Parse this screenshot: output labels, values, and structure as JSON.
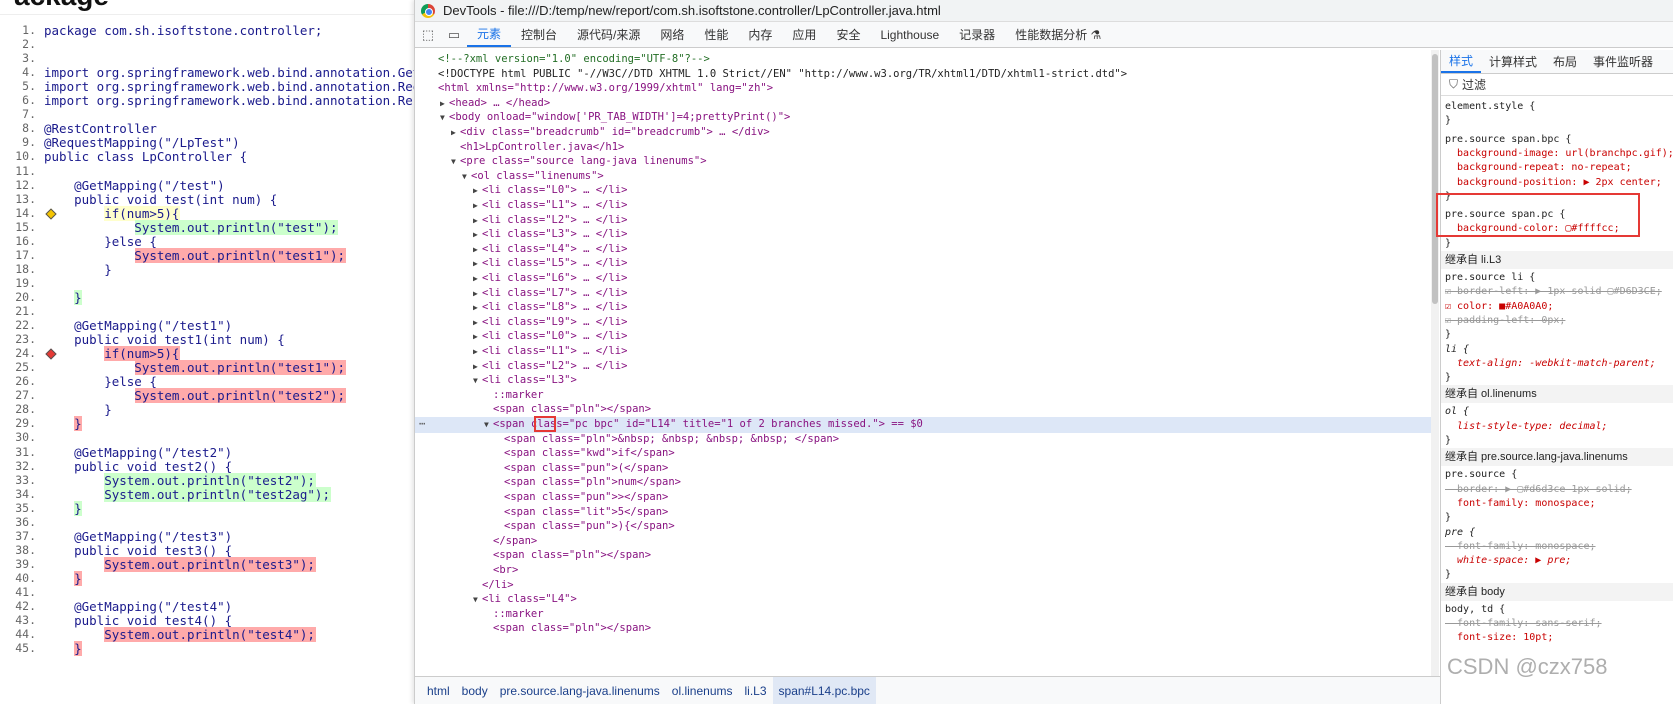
{
  "page_title_fragment": "ackage",
  "code_lines": [
    {
      "n": "1.",
      "t": "package com.sh.isoftstone.controller;"
    },
    {
      "n": "2.",
      "t": ""
    },
    {
      "n": "3.",
      "t": ""
    },
    {
      "n": "4.",
      "t": "import org.springframework.web.bind.annotation.GetMa"
    },
    {
      "n": "5.",
      "t": "import org.springframework.web.bind.annotation.Reque"
    },
    {
      "n": "6.",
      "t": "import org.springframework.web.bind.annotation.RestC"
    },
    {
      "n": "7.",
      "t": ""
    },
    {
      "n": "8.",
      "t": "@RestController"
    },
    {
      "n": "9.",
      "t": "@RequestMapping(\"/LpTest\")"
    },
    {
      "n": "10.",
      "t": "public class LpController {"
    },
    {
      "n": "11.",
      "t": ""
    },
    {
      "n": "12.",
      "t": "    @GetMapping(\"/test\")"
    },
    {
      "n": "13.",
      "t": "    public void test(int num) {"
    },
    {
      "n": "14.",
      "t": "        if(num>5){",
      "h": "y",
      "m": "y"
    },
    {
      "n": "15.",
      "t": "            System.out.println(\"test\");",
      "h": "g"
    },
    {
      "n": "16.",
      "t": "        }else {"
    },
    {
      "n": "17.",
      "t": "            System.out.println(\"test1\");",
      "h": "r"
    },
    {
      "n": "18.",
      "t": "        }"
    },
    {
      "n": "19.",
      "t": ""
    },
    {
      "n": "20.",
      "t": "    }",
      "h": "g"
    },
    {
      "n": "21.",
      "t": ""
    },
    {
      "n": "22.",
      "t": "    @GetMapping(\"/test1\")"
    },
    {
      "n": "23.",
      "t": "    public void test1(int num) {"
    },
    {
      "n": "24.",
      "t": "        if(num>5){",
      "h": "r",
      "m": "r"
    },
    {
      "n": "25.",
      "t": "            System.out.println(\"test1\");",
      "h": "r"
    },
    {
      "n": "26.",
      "t": "        }else {"
    },
    {
      "n": "27.",
      "t": "            System.out.println(\"test2\");",
      "h": "r"
    },
    {
      "n": "28.",
      "t": "        }"
    },
    {
      "n": "29.",
      "t": "    }",
      "h": "r"
    },
    {
      "n": "30.",
      "t": ""
    },
    {
      "n": "31.",
      "t": "    @GetMapping(\"/test2\")"
    },
    {
      "n": "32.",
      "t": "    public void test2() {"
    },
    {
      "n": "33.",
      "t": "        System.out.println(\"test2\");",
      "h": "g"
    },
    {
      "n": "34.",
      "t": "        System.out.println(\"test2ag\");",
      "h": "g"
    },
    {
      "n": "35.",
      "t": "    }",
      "h": "g"
    },
    {
      "n": "36.",
      "t": ""
    },
    {
      "n": "37.",
      "t": "    @GetMapping(\"/test3\")"
    },
    {
      "n": "38.",
      "t": "    public void test3() {"
    },
    {
      "n": "39.",
      "t": "        System.out.println(\"test3\");",
      "h": "r"
    },
    {
      "n": "40.",
      "t": "    }",
      "h": "r"
    },
    {
      "n": "41.",
      "t": ""
    },
    {
      "n": "42.",
      "t": "    @GetMapping(\"/test4\")"
    },
    {
      "n": "43.",
      "t": "    public void test4() {"
    },
    {
      "n": "44.",
      "t": "        System.out.println(\"test4\");",
      "h": "r"
    },
    {
      "n": "45.",
      "t": "    }",
      "h": "r"
    }
  ],
  "devtools": {
    "title": "DevTools - file:///D:/temp/new/report/com.sh.isoftstone.controller/LpController.java.html",
    "tabs": [
      "元素",
      "控制台",
      "源代码/来源",
      "网络",
      "性能",
      "内存",
      "应用",
      "安全",
      "Lighthouse",
      "记录器",
      "性能数据分析 ⚗"
    ],
    "dom_lines": [
      {
        "i": 0,
        "x": "",
        "h": "<!--?xml version=\"1.0\" encoding=\"UTF-8\"?-->",
        "c": "cm"
      },
      {
        "i": 0,
        "x": "",
        "h": "<!DOCTYPE html PUBLIC \"-//W3C//DTD XHTML 1.0 Strict//EN\" \"http://www.w3.org/TR/xhtml1/DTD/xhtml1-strict.dtd\">",
        "c": "tx"
      },
      {
        "i": 0,
        "x": "",
        "h": "<html xmlns=\"http://www.w3.org/1999/xhtml\" lang=\"zh\">",
        "c": "tg"
      },
      {
        "i": 1,
        "x": "▶",
        "h": "<head> … </head>",
        "c": "tg"
      },
      {
        "i": 1,
        "x": "▼",
        "h": "<body onload=\"window['PR_TAB_WIDTH']=4;prettyPrint()\">",
        "c": "tg"
      },
      {
        "i": 2,
        "x": "▶",
        "h": "<div class=\"breadcrumb\" id=\"breadcrumb\"> … </div>",
        "c": "tg"
      },
      {
        "i": 2,
        "x": "",
        "h": "<h1>LpController.java</h1>",
        "c": "tg"
      },
      {
        "i": 2,
        "x": "▼",
        "h": "<pre class=\"source lang-java linenums\">",
        "c": "tg"
      },
      {
        "i": 3,
        "x": "▼",
        "h": "<ol class=\"linenums\">",
        "c": "tg"
      },
      {
        "i": 4,
        "x": "▶",
        "h": "<li class=\"L0\"> … </li>",
        "c": "tg"
      },
      {
        "i": 4,
        "x": "▶",
        "h": "<li class=\"L1\"> … </li>",
        "c": "tg"
      },
      {
        "i": 4,
        "x": "▶",
        "h": "<li class=\"L2\"> … </li>",
        "c": "tg"
      },
      {
        "i": 4,
        "x": "▶",
        "h": "<li class=\"L3\"> … </li>",
        "c": "tg"
      },
      {
        "i": 4,
        "x": "▶",
        "h": "<li class=\"L4\"> … </li>",
        "c": "tg"
      },
      {
        "i": 4,
        "x": "▶",
        "h": "<li class=\"L5\"> … </li>",
        "c": "tg"
      },
      {
        "i": 4,
        "x": "▶",
        "h": "<li class=\"L6\"> … </li>",
        "c": "tg"
      },
      {
        "i": 4,
        "x": "▶",
        "h": "<li class=\"L7\"> … </li>",
        "c": "tg"
      },
      {
        "i": 4,
        "x": "▶",
        "h": "<li class=\"L8\"> … </li>",
        "c": "tg"
      },
      {
        "i": 4,
        "x": "▶",
        "h": "<li class=\"L9\"> … </li>",
        "c": "tg"
      },
      {
        "i": 4,
        "x": "▶",
        "h": "<li class=\"L0\"> … </li>",
        "c": "tg"
      },
      {
        "i": 4,
        "x": "▶",
        "h": "<li class=\"L1\"> … </li>",
        "c": "tg"
      },
      {
        "i": 4,
        "x": "▶",
        "h": "<li class=\"L2\"> … </li>",
        "c": "tg"
      },
      {
        "i": 4,
        "x": "▼",
        "h": "<li class=\"L3\">",
        "c": "tg"
      },
      {
        "i": 5,
        "x": "",
        "h": "::marker",
        "c": "mr"
      },
      {
        "i": 5,
        "x": "",
        "h": "<span class=\"pln\"></span>",
        "c": "tg"
      },
      {
        "i": 5,
        "x": "▼",
        "h": "<span class=\"pc bpc\" id=\"L14\" title=\"1 of 2 branches missed.\"> == $0",
        "c": "tg",
        "sel": true
      },
      {
        "i": 6,
        "x": "",
        "h": "<span class=\"pln\">&nbsp; &nbsp; &nbsp; &nbsp; </span>",
        "c": "tg"
      },
      {
        "i": 6,
        "x": "",
        "h": "<span class=\"kwd\">if</span>",
        "c": "tg"
      },
      {
        "i": 6,
        "x": "",
        "h": "<span class=\"pun\">(</span>",
        "c": "tg"
      },
      {
        "i": 6,
        "x": "",
        "h": "<span class=\"pln\">num</span>",
        "c": "tg"
      },
      {
        "i": 6,
        "x": "",
        "h": "<span class=\"pun\">></span>",
        "c": "tg"
      },
      {
        "i": 6,
        "x": "",
        "h": "<span class=\"lit\">5</span>",
        "c": "tg"
      },
      {
        "i": 6,
        "x": "",
        "h": "<span class=\"pun\">){</span>",
        "c": "tg"
      },
      {
        "i": 5,
        "x": "",
        "h": "</span>",
        "c": "tg"
      },
      {
        "i": 5,
        "x": "",
        "h": "<span class=\"pln\"></span>",
        "c": "tg"
      },
      {
        "i": 5,
        "x": "",
        "h": "<br>",
        "c": "tg"
      },
      {
        "i": 4,
        "x": "",
        "h": "</li>",
        "c": "tg"
      },
      {
        "i": 4,
        "x": "▼",
        "h": "<li class=\"L4\">",
        "c": "tg"
      },
      {
        "i": 5,
        "x": "",
        "h": "::marker",
        "c": "mr"
      },
      {
        "i": 5,
        "x": "",
        "h": "<span class=\"pln\"></span>",
        "c": "tg"
      }
    ],
    "breadcrumbs": [
      "html",
      "body",
      "pre.source.lang-java.linenums",
      "ol.linenums",
      "li.L3",
      "span#L14.pc.bpc"
    ],
    "style_tabs": [
      "样式",
      "计算样式",
      "布局",
      "事件监听器"
    ],
    "filter_label": "过滤",
    "style_lines": [
      {
        "t": "element.style {",
        "k": "sel"
      },
      {
        "t": "}",
        "k": "sel"
      },
      {
        "t": "",
        "k": "gap"
      },
      {
        "t": "pre.source span.bpc {",
        "k": "sel"
      },
      {
        "t": "  background-image: url(branchpc.gif);",
        "k": "prop"
      },
      {
        "t": "  background-repeat: no-repeat;",
        "k": "prop"
      },
      {
        "t": "  background-position: ▶ 2px center;",
        "k": "prop"
      },
      {
        "t": "}",
        "k": "sel"
      },
      {
        "t": "",
        "k": "gap"
      },
      {
        "t": "pre.source span.pc {",
        "k": "sel"
      },
      {
        "t": "  background-color: ▢#ffffcc;",
        "k": "prop"
      },
      {
        "t": "}",
        "k": "sel"
      },
      {
        "t": "继承自 li.L3",
        "k": "sep"
      },
      {
        "t": "pre.source li {",
        "k": "sel"
      },
      {
        "t": "☑ border-left: ▶ 1px solid ▢#D6D3CE;",
        "k": "strike"
      },
      {
        "t": "☑ color: ■#A0A0A0;",
        "k": "prop"
      },
      {
        "t": "☑ padding-left: 0px;",
        "k": "strike"
      },
      {
        "t": "}",
        "k": "sel"
      },
      {
        "t": "li {",
        "k": "it"
      },
      {
        "t": "  text-align: -webkit-match-parent;",
        "k": "itp"
      },
      {
        "t": "}",
        "k": "sel"
      },
      {
        "t": "继承自 ol.linenums",
        "k": "sep"
      },
      {
        "t": "ol {",
        "k": "it"
      },
      {
        "t": "  list-style-type: decimal;",
        "k": "itp"
      },
      {
        "t": "}",
        "k": "sel"
      },
      {
        "t": "继承自 pre.source.lang-java.linenums",
        "k": "sep"
      },
      {
        "t": "pre.source {",
        "k": "sel"
      },
      {
        "t": "  border: ▶ ▢#d6d3ce 1px solid;",
        "k": "strike"
      },
      {
        "t": "  font-family: monospace;",
        "k": "prop"
      },
      {
        "t": "}",
        "k": "sel"
      },
      {
        "t": "pre {",
        "k": "it"
      },
      {
        "t": "  font-family: monospace;",
        "k": "strike"
      },
      {
        "t": "  white-space: ▶ pre;",
        "k": "itp"
      },
      {
        "t": "}",
        "k": "sel"
      },
      {
        "t": "继承自 body",
        "k": "sep"
      },
      {
        "t": "body, td {",
        "k": "sel"
      },
      {
        "t": "  font-family: sans-serif;",
        "k": "strike"
      },
      {
        "t": "  font-size: 10pt;",
        "k": "prop"
      }
    ]
  },
  "watermark": "CSDN @czx758"
}
